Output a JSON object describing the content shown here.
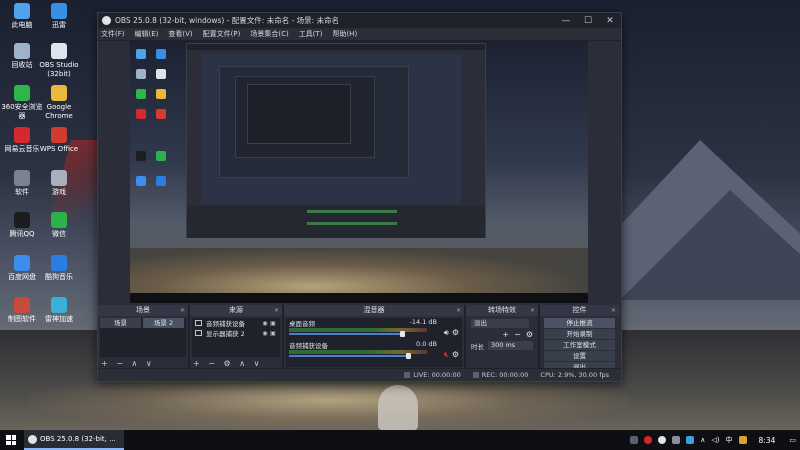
{
  "desktop": {
    "icons": [
      {
        "label": "此电脑",
        "color": "#4fa3e8"
      },
      {
        "label": "迅雷",
        "color": "#3a8ee6"
      },
      {
        "label": "回收站",
        "color": "#9fb3c8"
      },
      {
        "label": "OBS Studio (32bit)",
        "color": "#dfe3ea"
      },
      {
        "label": "360安全浏览器",
        "color": "#2fb54a"
      },
      {
        "label": "Google Chrome",
        "color": "#e8b93a"
      },
      {
        "label": "网易云音乐",
        "color": "#d7282f"
      },
      {
        "label": "WPS Office",
        "color": "#d23b2e"
      },
      {
        "label": "软件",
        "color": "#7a8290"
      },
      {
        "label": "游戏",
        "color": "#a8b0bc"
      },
      {
        "label": "腾讯QQ",
        "color": "#1d1d1d"
      },
      {
        "label": "微信",
        "color": "#2bb24c"
      },
      {
        "label": "百度网盘",
        "color": "#3b8ef0"
      },
      {
        "label": "酷狗音乐",
        "color": "#2a7de1"
      },
      {
        "label": "制图软件",
        "color": "#c84a3a"
      },
      {
        "label": "雷神加速",
        "color": "#3ab0d8"
      }
    ]
  },
  "obs": {
    "title": "OBS 25.0.8 (32-bit, windows) - 配置文件: 未命名 - 场景: 未命名",
    "window_buttons": {
      "minimize": "—",
      "maximize": "☐",
      "close": "✕"
    },
    "menu": [
      "文件(F)",
      "编辑(E)",
      "查看(V)",
      "配置文件(P)",
      "场景集合(C)",
      "工具(T)",
      "帮助(H)"
    ],
    "docks": {
      "scenes": {
        "title": "场景",
        "items": [
          "场景",
          "场景 2"
        ],
        "selected": 1,
        "footer": "+ − ∧ ∨"
      },
      "sources": {
        "title": "来源",
        "items": [
          "音频捕获设备",
          "显示器捕获 2"
        ],
        "footer": "+ − ⚙ ∧ ∨"
      },
      "mixer": {
        "title": "混音器",
        "channels": [
          {
            "name": "桌面音频",
            "db": "-14.1 dB",
            "fader": 0.82,
            "muted": false
          },
          {
            "name": "音频捕获设备",
            "db": "0.0 dB",
            "fader": 0.86,
            "muted": true
          }
        ]
      },
      "transitions": {
        "title": "转场特效",
        "selected": "淡出",
        "duration_label": "时长",
        "duration_value": "300 ms"
      },
      "controls": {
        "title": "控件",
        "buttons": [
          "停止推流",
          "开始录制",
          "工作室模式",
          "设置",
          "退出"
        ]
      }
    },
    "status": {
      "live": "LIVE: 00:00:00",
      "rec": "REC: 00:00:00",
      "cpu": "CPU: 2.9%, 30.00 fps"
    }
  },
  "taskbar": {
    "app_label": "OBS 25.0.8 (32-bit, ...",
    "tray": {
      "ime": "中",
      "time": "8:34"
    }
  },
  "colors": {
    "obs_bg": "#2b2e38",
    "accent": "#4a7fd0",
    "mute_red": "#d63a3a"
  }
}
